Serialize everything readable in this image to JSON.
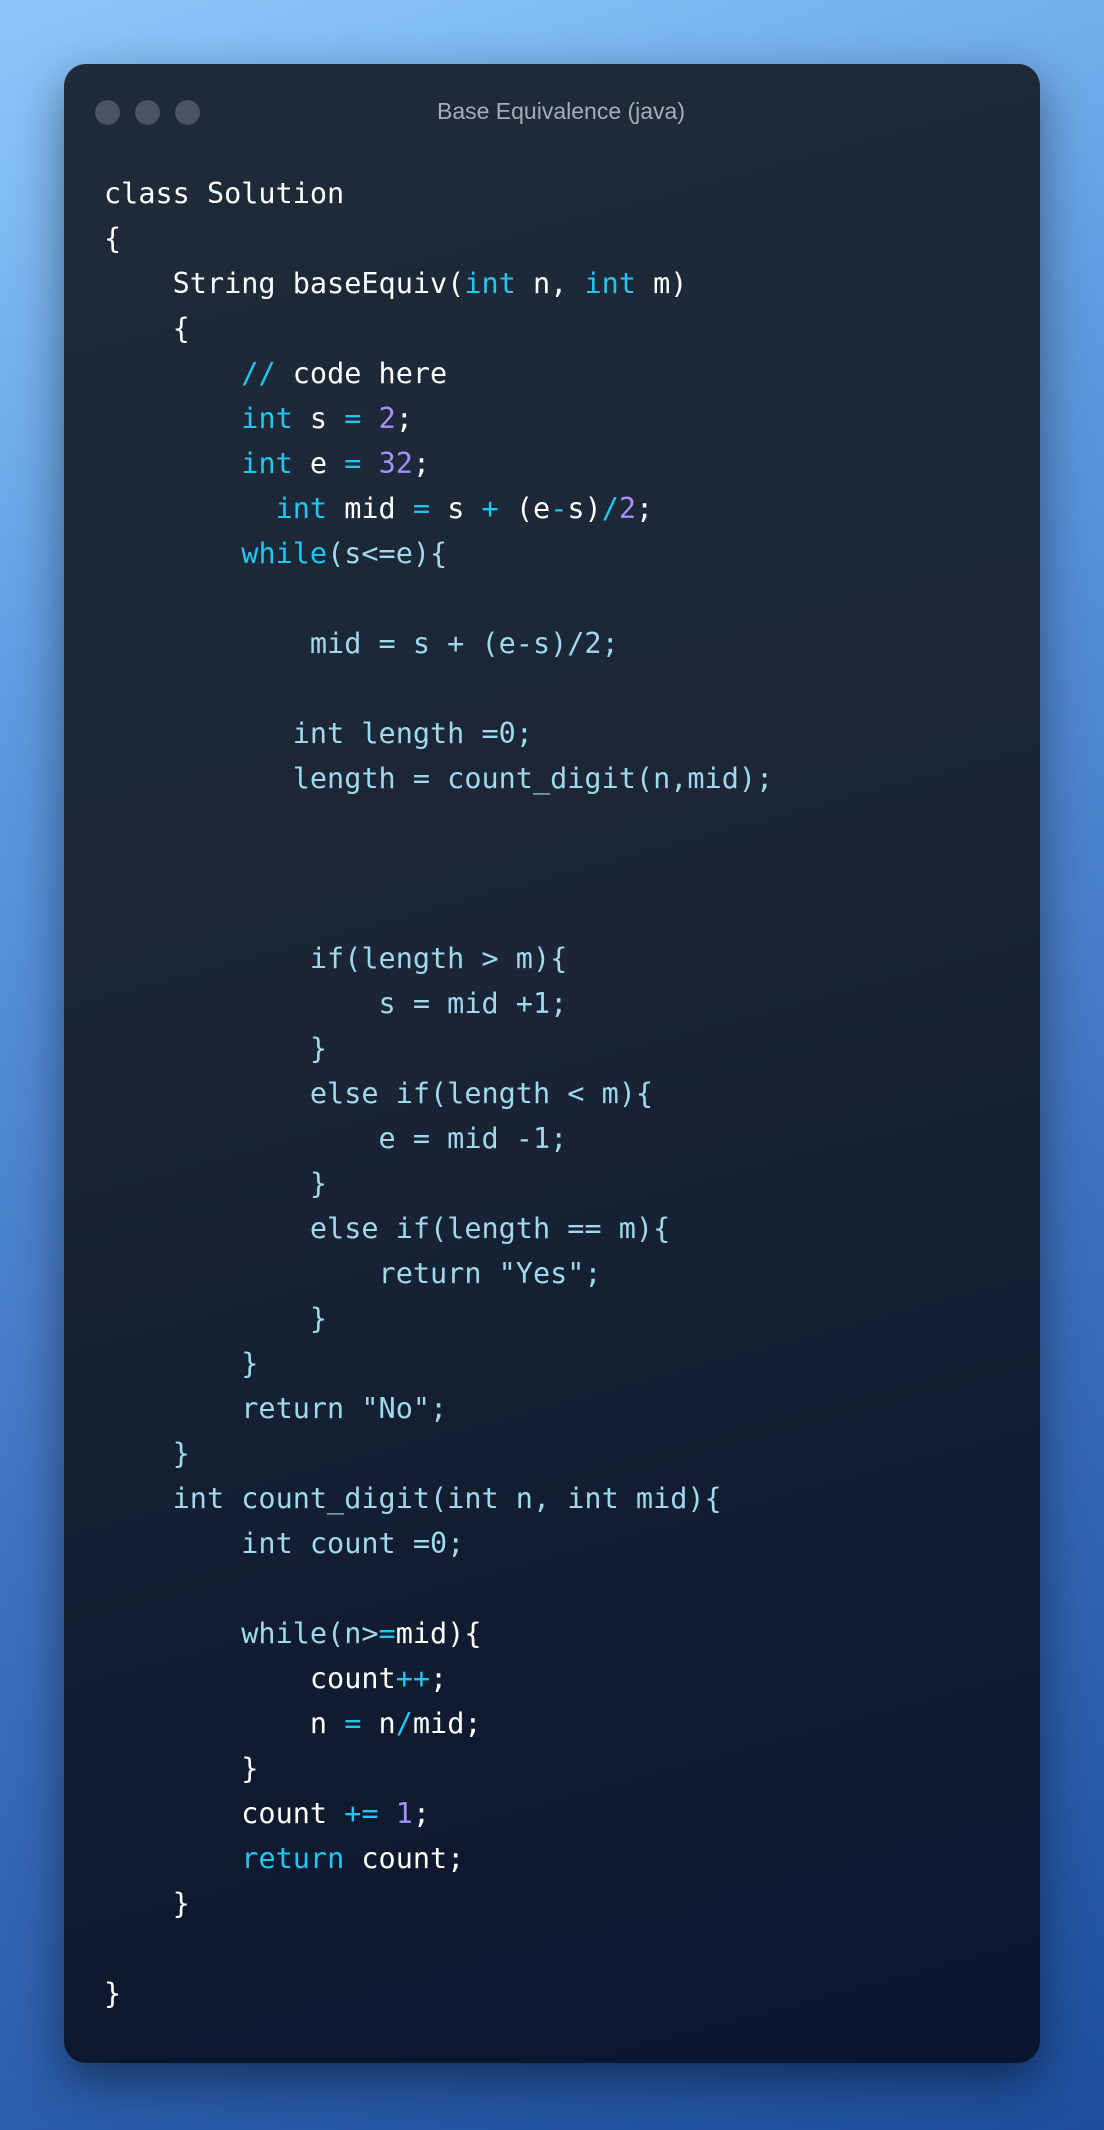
{
  "window": {
    "title": "Base Equivalence (java)",
    "controls": [
      "close",
      "minimize",
      "maximize"
    ]
  },
  "code_lines": [
    [
      {
        "t": "class Solution",
        "c": "w"
      }
    ],
    [
      {
        "t": "{",
        "c": "w"
      }
    ],
    [
      {
        "t": "    String baseEquiv(",
        "c": "w"
      },
      {
        "t": "int",
        "c": "k"
      },
      {
        "t": " n, ",
        "c": "w"
      },
      {
        "t": "int",
        "c": "k"
      },
      {
        "t": " m)",
        "c": "w"
      }
    ],
    [
      {
        "t": "    {",
        "c": "w"
      }
    ],
    [
      {
        "t": "        ",
        "c": "w"
      },
      {
        "t": "//",
        "c": "k"
      },
      {
        "t": " code here",
        "c": "w"
      }
    ],
    [
      {
        "t": "        ",
        "c": "w"
      },
      {
        "t": "int",
        "c": "k"
      },
      {
        "t": " s ",
        "c": "w"
      },
      {
        "t": "=",
        "c": "k"
      },
      {
        "t": " ",
        "c": "w"
      },
      {
        "t": "2",
        "c": "n"
      },
      {
        "t": ";",
        "c": "w"
      }
    ],
    [
      {
        "t": "        ",
        "c": "w"
      },
      {
        "t": "int",
        "c": "k"
      },
      {
        "t": " e ",
        "c": "w"
      },
      {
        "t": "=",
        "c": "k"
      },
      {
        "t": " ",
        "c": "w"
      },
      {
        "t": "32",
        "c": "n"
      },
      {
        "t": ";",
        "c": "w"
      }
    ],
    [
      {
        "t": "          ",
        "c": "w"
      },
      {
        "t": "int",
        "c": "k"
      },
      {
        "t": " mid ",
        "c": "w"
      },
      {
        "t": "=",
        "c": "k"
      },
      {
        "t": " s ",
        "c": "w"
      },
      {
        "t": "+",
        "c": "k"
      },
      {
        "t": " (e",
        "c": "w"
      },
      {
        "t": "-",
        "c": "k"
      },
      {
        "t": "s)",
        "c": "w"
      },
      {
        "t": "/",
        "c": "k"
      },
      {
        "t": "2",
        "c": "n"
      },
      {
        "t": ";",
        "c": "w"
      }
    ],
    [
      {
        "t": "        ",
        "c": "w"
      },
      {
        "t": "while",
        "c": "k"
      },
      {
        "t": "(s<=e){",
        "c": "c"
      }
    ],
    [],
    [
      {
        "t": "            mid = s + (e-s)/2;",
        "c": "c"
      }
    ],
    [],
    [
      {
        "t": "           int length =0;",
        "c": "c"
      }
    ],
    [
      {
        "t": "           length = count_digit(n,mid);",
        "c": "c"
      }
    ],
    [],
    [],
    [],
    [
      {
        "t": "            if(length > m){",
        "c": "c"
      }
    ],
    [
      {
        "t": "                s = mid +1;",
        "c": "c"
      }
    ],
    [
      {
        "t": "            }",
        "c": "c"
      }
    ],
    [
      {
        "t": "            else if(length < m){",
        "c": "c"
      }
    ],
    [
      {
        "t": "                e = mid -1;",
        "c": "c"
      }
    ],
    [
      {
        "t": "            }",
        "c": "c"
      }
    ],
    [
      {
        "t": "            else if(length == m){",
        "c": "c"
      }
    ],
    [
      {
        "t": "                return \"Yes\";",
        "c": "c"
      }
    ],
    [
      {
        "t": "            }",
        "c": "c"
      }
    ],
    [
      {
        "t": "        }",
        "c": "c"
      }
    ],
    [
      {
        "t": "        return \"No\";",
        "c": "c"
      }
    ],
    [
      {
        "t": "    }",
        "c": "c"
      }
    ],
    [
      {
        "t": "    int count_digit(int n, int mid){",
        "c": "c"
      }
    ],
    [
      {
        "t": "        int count =0;",
        "c": "c"
      }
    ],
    [],
    [
      {
        "t": "        while(n>",
        "c": "c"
      },
      {
        "t": "=",
        "c": "k"
      },
      {
        "t": "mid){",
        "c": "w"
      }
    ],
    [
      {
        "t": "            count",
        "c": "w"
      },
      {
        "t": "++",
        "c": "k"
      },
      {
        "t": ";",
        "c": "w"
      }
    ],
    [
      {
        "t": "            n ",
        "c": "w"
      },
      {
        "t": "=",
        "c": "k"
      },
      {
        "t": " n",
        "c": "w"
      },
      {
        "t": "/",
        "c": "k"
      },
      {
        "t": "mid;",
        "c": "w"
      }
    ],
    [
      {
        "t": "        }",
        "c": "w"
      }
    ],
    [
      {
        "t": "        count ",
        "c": "w"
      },
      {
        "t": "+=",
        "c": "k"
      },
      {
        "t": " ",
        "c": "w"
      },
      {
        "t": "1",
        "c": "n"
      },
      {
        "t": ";",
        "c": "w"
      }
    ],
    [
      {
        "t": "        ",
        "c": "w"
      },
      {
        "t": "return",
        "c": "k"
      },
      {
        "t": " count;",
        "c": "w"
      }
    ],
    [
      {
        "t": "    }",
        "c": "w"
      }
    ],
    [],
    [
      {
        "t": "}",
        "c": "w"
      }
    ]
  ],
  "colors": {
    "keyword": "#22c6f2",
    "number": "#a88ef8",
    "plain": "#ffffff",
    "muted_code": "#9fd9ec",
    "window_bg": "#1b2536"
  }
}
